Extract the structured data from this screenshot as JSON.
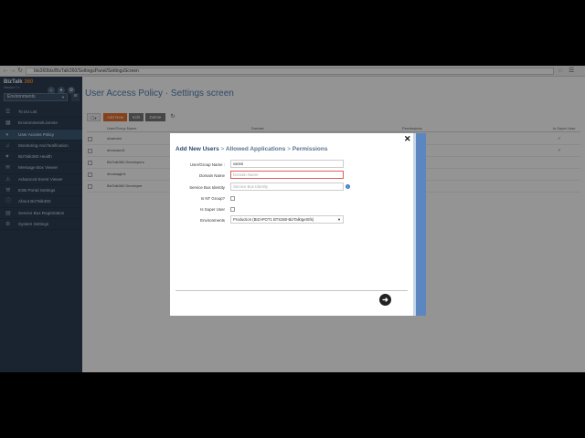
{
  "browser": {
    "url": "bts360bts/BizTalk360/SettingsPanel/SettingsScreen",
    "back_icon": "back-arrow-icon",
    "forward_icon": "forward-arrow-icon",
    "reload_icon": "reload-icon"
  },
  "app": {
    "brand": "BizTalk",
    "brand_accent": "360",
    "brand_sub": "Version 7.x",
    "environment": "Environments",
    "accent_color": "#e3702d",
    "sidebar_color": "#2b3f54"
  },
  "sidebar": {
    "items": [
      {
        "label": "To Do List",
        "icon": "list-icon",
        "active": false
      },
      {
        "label": "Environment/License",
        "icon": "license-icon",
        "active": false
      },
      {
        "label": "User Access Policy",
        "icon": "user-icon",
        "active": true
      },
      {
        "label": "Monitoring And Notification",
        "icon": "bell-icon",
        "active": false
      },
      {
        "label": "BizTalk360 Health",
        "icon": "heart-icon",
        "active": false
      },
      {
        "label": "Message Box Viewer",
        "icon": "mail-icon",
        "active": false
      },
      {
        "label": "Advanced Event Viewer",
        "icon": "event-icon",
        "active": false
      },
      {
        "label": "ESB Portal Settings",
        "icon": "wrench-icon",
        "active": false
      },
      {
        "label": "About BizTalk360",
        "icon": "info-icon",
        "active": false
      },
      {
        "label": "Service Bus Registration",
        "icon": "bus-icon",
        "active": false
      },
      {
        "label": "System Settings",
        "icon": "gear-icon",
        "active": false
      }
    ]
  },
  "main": {
    "title": "User Access Policy · Settings screen",
    "toolbar": {
      "add_label": "Add New",
      "edit_label": "Edit",
      "delete_label": "Delete"
    },
    "columns": [
      "User/Group Name",
      "Domain",
      "Permissions",
      "Is Super User"
    ],
    "rows": [
      {
        "name": "sivamani",
        "super": "✓"
      },
      {
        "name": "devanand1",
        "super": "✓"
      },
      {
        "name": "BizTalk360 Developers",
        "super": ""
      },
      {
        "name": "devanagiri1",
        "super": ""
      },
      {
        "name": "BizTalk360 Developer",
        "super": ""
      }
    ]
  },
  "modal": {
    "title_main": "Add New Users",
    "title_sep1": ">",
    "title_step2": "Allowed Applications",
    "title_sep2": ">",
    "title_step3": "Permissions",
    "fields": {
      "user_label": "User/Group Name :",
      "user_value": "vamsi",
      "domain_label": "Domain Name",
      "domain_placeholder": "Domain Name",
      "sbid_label": "Service Bus Identity",
      "sbid_placeholder": "Service Bus Identity",
      "ntgroup_label": "Is NT Group?",
      "superuser_label": "Is Super User",
      "env_label": "Environments",
      "env_value": "Production (BIZAPOT1 BTS360-BizTalkIgetSfs)"
    }
  }
}
